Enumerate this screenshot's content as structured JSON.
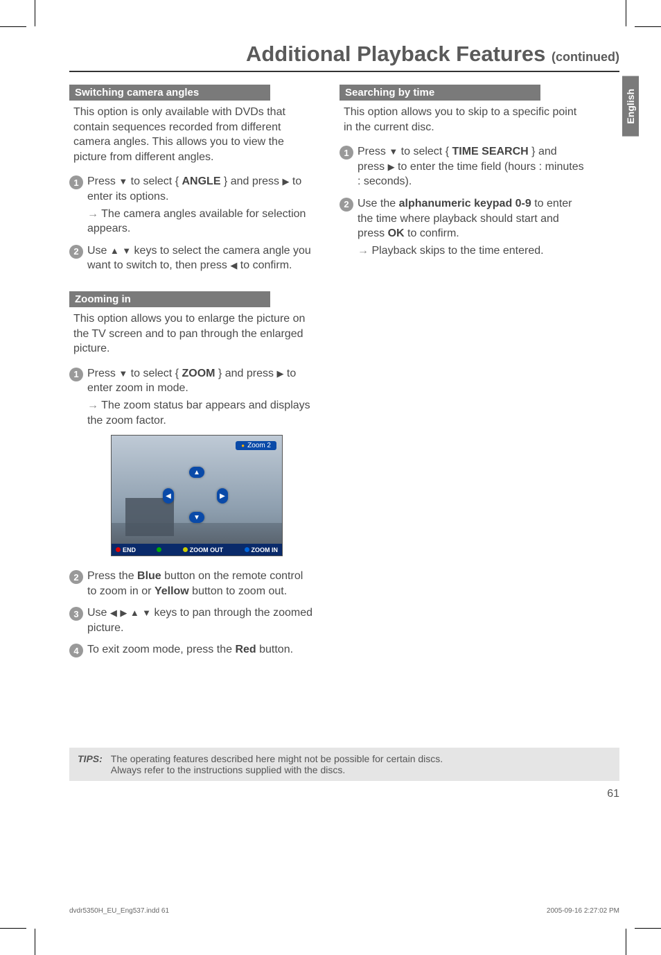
{
  "lang_tab": "English",
  "title_main": "Additional Playback Features ",
  "title_cont": "(continued)",
  "section_a": {
    "head": "Switching camera angles",
    "intro": "This option is only available with DVDs that contain sequences recorded from different camera angles. This allows you to view the picture from different angles.",
    "step1_prefix": "Press ",
    "step1_mid": " to select { ",
    "step1_bold": "ANGLE",
    "step1_suffix": " } and press ",
    "step1_end": " to enter its options.",
    "step1_result": " The camera angles available for selection appears.",
    "step2_prefix": "Use ",
    "step2_mid": " keys to select the camera angle you want to switch to, then press ",
    "step2_end": " to confirm."
  },
  "section_b": {
    "head": "Zooming in",
    "intro": "This option allows you to enlarge the picture on the TV screen and to pan through the enlarged picture.",
    "step1_prefix": "Press ",
    "step1_mid": " to select { ",
    "step1_bold": "ZOOM",
    "step1_suffix": " } and press ",
    "step1_end": " to enter zoom in mode.",
    "step1_result": " The zoom status bar appears and displays the zoom factor.",
    "zoom_badge": "Zoom 2",
    "bar_end": "END",
    "bar_zoomout": "ZOOM OUT",
    "bar_zoomin": "ZOOM IN",
    "step2_prefix": "Press the ",
    "step2_bold1": "Blue",
    "step2_mid": " button on the remote control to zoom in or ",
    "step2_bold2": "Yellow",
    "step2_end": " button to zoom out.",
    "step3_prefix": "Use ",
    "step3_end": " keys to pan through the zoomed picture.",
    "step4_prefix": "To exit zoom mode, press the ",
    "step4_bold": "Red",
    "step4_end": " button."
  },
  "section_c": {
    "head": "Searching by time",
    "intro": "This option allows you to skip to a specific point in the current disc.",
    "step1_prefix": "Press ",
    "step1_mid": " to select { ",
    "step1_bold": "TIME SEARCH",
    "step1_suffix": " } and press ",
    "step1_end": " to enter the time field (hours : minutes : seconds).",
    "step2_prefix": "Use the ",
    "step2_bold1": "alphanumeric keypad 0-9",
    "step2_mid": " to enter the time where playback should start and press ",
    "step2_bold2": "OK",
    "step2_end": " to confirm.",
    "step2_result": " Playback skips to the time entered."
  },
  "tips": {
    "label": "TIPS:",
    "line1": "The operating features described here might not be possible for certain discs.",
    "line2": "Always refer to the instructions supplied with the discs."
  },
  "page_number": "61",
  "footer_left": "dvdr5350H_EU_Eng537.indd   61",
  "footer_right": "2005-09-16   2:27:02 PM"
}
